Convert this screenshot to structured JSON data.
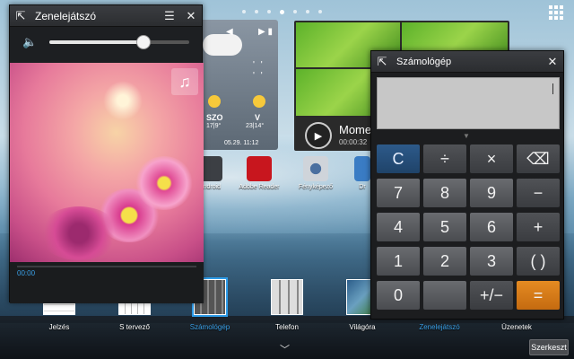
{
  "music_player": {
    "title": "Zenelejátszó",
    "volume_level": 0.67,
    "elapsed_time": "00:00"
  },
  "weather_widget": {
    "days": [
      {
        "name": "SZO",
        "temp": "17|9°"
      },
      {
        "name": "V",
        "temp": "23|14°"
      }
    ],
    "datetime": "05.29. 11:12"
  },
  "video_widget": {
    "title": "Mome",
    "time": "00:00:32"
  },
  "desktop_icons": [
    {
      "label": "Android",
      "icon": "android-icon"
    },
    {
      "label": "Adobe Reader",
      "icon": "adobe-reader-icon"
    },
    {
      "label": "Fényképező",
      "icon": "camera-icon"
    },
    {
      "label": "Dr",
      "icon": "app-icon"
    }
  ],
  "calculator": {
    "title": "Számológép",
    "display_value": "",
    "keys": [
      "C",
      "÷",
      "×",
      "⌫",
      "7",
      "8",
      "9",
      "−",
      "4",
      "5",
      "6",
      "+",
      "1",
      "2",
      "3",
      "( )",
      "0",
      "",
      "+/−",
      "="
    ]
  },
  "recent_apps": [
    {
      "label": "Jelzés",
      "icon": "alarm-icon"
    },
    {
      "label": "S tervező",
      "icon": "calendar-icon"
    },
    {
      "label": "Számológép",
      "icon": "calculator-icon",
      "active": true
    },
    {
      "label": "Telefon",
      "icon": "phone-icon"
    },
    {
      "label": "Világóra",
      "icon": "world-clock-icon"
    },
    {
      "label": "Zenelejátszó",
      "icon": "music-player-icon",
      "active": true
    },
    {
      "label": "Üzenetek",
      "icon": "messages-icon"
    }
  ],
  "bottom_bar": {
    "edit_label": "Szerkeszt"
  },
  "colors": {
    "accent": "#2d9be8",
    "calc_equals": "#e48b22",
    "calc_clear": "#2d5a8a"
  }
}
